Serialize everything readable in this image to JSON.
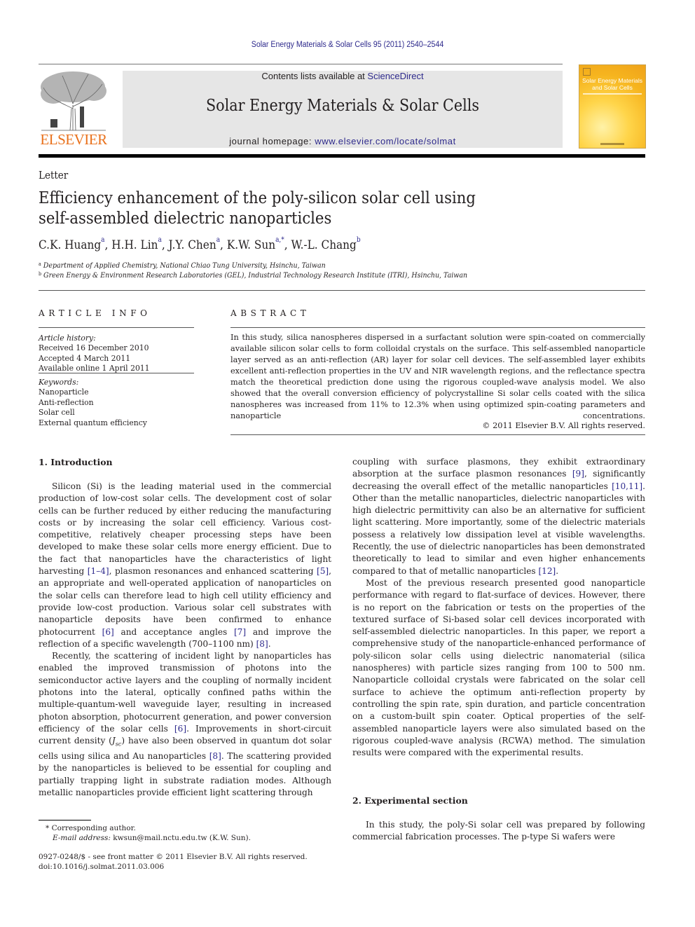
{
  "header": {
    "journal_ref": "Solar Energy Materials & Solar Cells 95 (2011) 2540–2544",
    "publisher_logo_text": "ELSEVIER",
    "contents_prefix": "Contents lists available at ",
    "contents_link": "ScienceDirect",
    "journal_title": "Solar Energy Materials & Solar Cells",
    "homepage_prefix": "journal homepage: ",
    "homepage_link": "www.elsevier.com/locate/solmat",
    "cover_title": "Solar Energy Materials and Solar Cells"
  },
  "article": {
    "type": "Letter",
    "title": "Efficiency enhancement of the poly-silicon solar cell using self-assembled dielectric nanoparticles",
    "authors": [
      {
        "name": "C.K. Huang",
        "sup": "a"
      },
      {
        "name": "H.H. Lin",
        "sup": "a"
      },
      {
        "name": "J.Y. Chen",
        "sup": "a"
      },
      {
        "name": "K.W. Sun",
        "sup": "a,*"
      },
      {
        "name": "W.-L. Chang",
        "sup": "b"
      }
    ],
    "affiliations": [
      {
        "label": "a",
        "text": "Department of Applied Chemistry, National Chiao Tung University, Hsinchu, Taiwan"
      },
      {
        "label": "b",
        "text": "Green Energy & Environment Research Laboratories (GEL), Industrial Technology Research Institute (ITRI), Hsinchu, Taiwan"
      }
    ]
  },
  "article_info": {
    "heading": "ARTICLE INFO",
    "history_label": "Article history:",
    "history": [
      "Received 16 December 2010",
      "Accepted 4 March 2011",
      "Available online 1 April 2011"
    ],
    "keywords_label": "Keywords:",
    "keywords": [
      "Nanoparticle",
      "Anti-reflection",
      "Solar cell",
      "External quantum efficiency"
    ]
  },
  "abstract": {
    "heading": "ABSTRACT",
    "text": "In this study, silica nanospheres dispersed in a surfactant solution were spin-coated on commercially available silicon solar cells to form colloidal crystals on the surface. This self-assembled nanoparticle layer served as an anti-reflection (AR) layer for solar cell devices. The self-assembled layer exhibits excellent anti-reflection properties in the UV and NIR wavelength regions, and the reflectance spectra match the theoretical prediction done using the rigorous coupled-wave analysis model. We also showed that the overall conversion efficiency of polycrystalline Si solar cells coated with the silica nanospheres was increased from 11% to 12.3% when using optimized spin-coating parameters and nanoparticle concentrations.",
    "copyright": "© 2011 Elsevier B.V. All rights reserved."
  },
  "body": {
    "sec1_heading": "1.  Introduction",
    "sec1_p1": [
      "Silicon (Si) is the leading material used in the commercial production of low-cost solar cells. The development cost of solar cells can be further reduced by either reducing the manufacturing costs or by increasing the solar cell efficiency. Various cost-competitive, relatively cheaper processing steps have been developed to make these solar cells more energy efficient. Due to the fact that nanoparticles have the characteristics of light harvesting ",
      "[1–4]",
      ", plasmon resonances and enhanced scattering ",
      "[5]",
      ", an appropriate and well-operated application of nanoparticles on the solar cells can therefore lead to high cell utility efficiency and provide low-cost production. Various solar cell substrates with nanoparticle deposits have been confirmed to enhance photocurrent ",
      "[6]",
      " and acceptance angles ",
      "[7]",
      " and improve the reflection of a specific wavelength (700–1100 nm) ",
      "[8]",
      "."
    ],
    "sec1_p2": [
      "Recently, the scattering of incident light by nanoparticles has enabled the improved transmission of photons into the semiconductor active layers and the coupling of normally incident photons into the lateral, optically confined paths within the multiple-quantum-well waveguide layer, resulting in increased photon absorption, photocurrent generation, and power conversion efficiency of the solar cells ",
      "[6]",
      ". Improvements in short-circuit current density (",
      "J",
      "sc",
      ") have also been observed in quantum dot solar cells using silica and Au nanoparticles ",
      "[8]",
      ". The scattering provided by the nanoparticles is believed to be essential for coupling and partially trapping light in substrate radiation modes. Although metallic nanoparticles provide efficient light scattering through"
    ],
    "col2_p1": [
      "coupling with surface plasmons, they exhibit extraordinary absorption at the surface plasmon resonances ",
      "[9]",
      ", significantly decreasing the overall effect of the metallic nanoparticles ",
      "[10,11]",
      ". Other than the metallic nanoparticles, dielectric nanoparticles with high dielectric permittivity can also be an alternative for sufficient light scattering. More importantly, some of the dielectric materials possess a relatively low dissipation level at visible wavelengths. Recently, the use of dielectric nanoparticles has been demonstrated theoretically to lead to similar and even higher enhancements compared to that of metallic nanoparticles ",
      "[12]",
      "."
    ],
    "col2_p2": "Most of the previous research presented good nanoparticle performance with regard to flat-surface of devices. However, there is no report on the fabrication or tests on the properties of the textured surface of Si-based solar cell devices incorporated with self-assembled dielectric nanoparticles. In this paper, we report a comprehensive study of the nanoparticle-enhanced performance of poly-silicon solar cells using dielectric nanomaterial (silica nanospheres) with particle sizes ranging from 100 to 500 nm. Nanoparticle colloidal crystals were fabricated on the solar cell surface to achieve the optimum anti-reflection property by controlling the spin rate, spin duration, and particle concentration on a custom-built spin coater. Optical properties of the self-assembled nanoparticle layers were also simulated based on the rigorous coupled-wave analysis (RCWA) method. The simulation results were compared with the experimental results.",
    "sec2_heading": "2.  Experimental section",
    "sec2_p1": "In this study, the poly-Si solar cell was prepared by following commercial fabrication processes. The p-type Si wafers were"
  },
  "footnotes": {
    "corresponding": "* Corresponding author.",
    "email_label": "E-mail address: ",
    "email": "kwsun@mail.nctu.edu.tw",
    "email_suffix": " (K.W. Sun).",
    "issn": "0927-0248/$ - see front matter © 2011 Elsevier B.V. All rights reserved.",
    "doi": "doi:10.1016/j.solmat.2011.03.006"
  }
}
